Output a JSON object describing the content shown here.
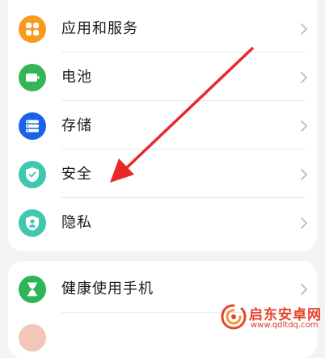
{
  "group1": {
    "items": [
      {
        "label": "应用和服务",
        "icon": "apps-icon",
        "color": "#f79a1e"
      },
      {
        "label": "电池",
        "icon": "battery-icon",
        "color": "#34b556"
      },
      {
        "label": "存储",
        "icon": "storage-icon",
        "color": "#1a63e8"
      },
      {
        "label": "安全",
        "icon": "shield-icon",
        "color": "#3fc7b0"
      },
      {
        "label": "隐私",
        "icon": "privacy-icon",
        "color": "#3fc7b0"
      }
    ]
  },
  "group2": {
    "items": [
      {
        "label": "健康使用手机",
        "icon": "hourglass-icon",
        "color": "#2eb656"
      }
    ]
  },
  "watermark": {
    "name": "启东安卓网",
    "url": "www.qdltdq.com"
  },
  "annotation_color": "#e8282a"
}
